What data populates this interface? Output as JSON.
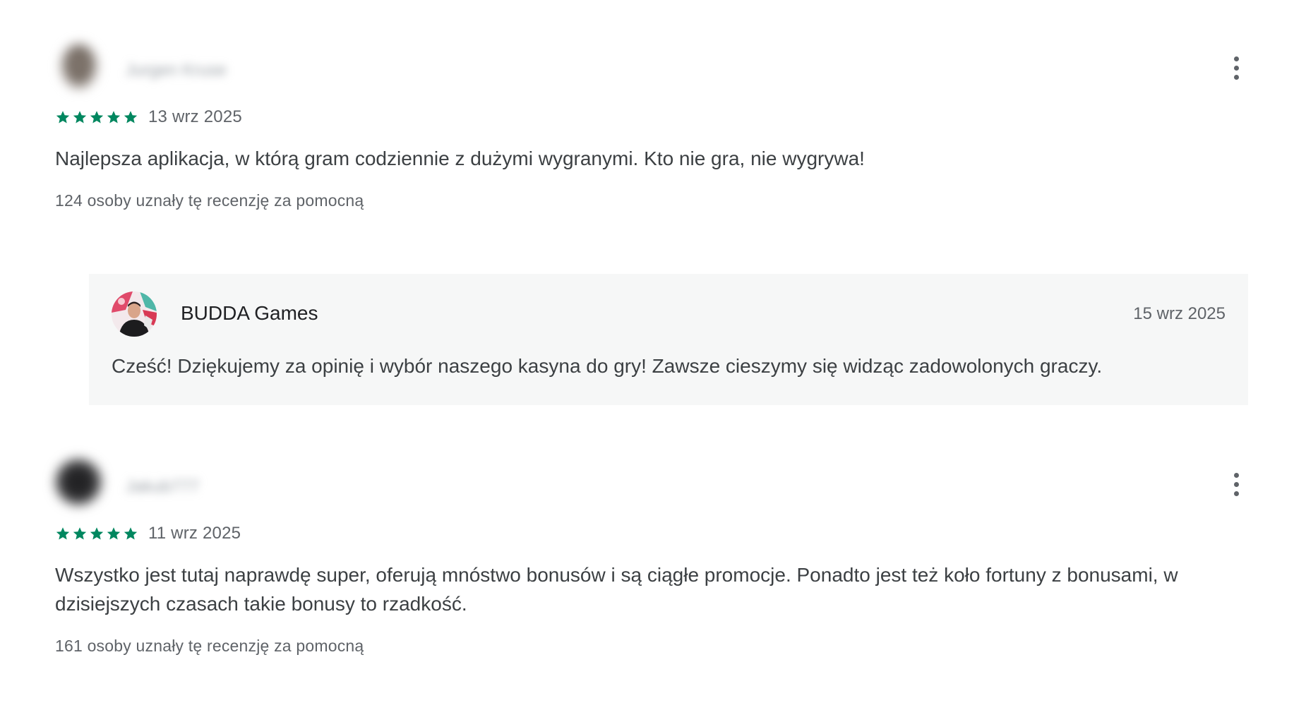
{
  "colors": {
    "star": "#01875f",
    "text": "#3c4043",
    "muted": "#5f6368",
    "reply_background": "#f6f7f7"
  },
  "icons": {
    "star": "star-icon",
    "more": "more-vert-icon"
  },
  "reviews": [
    {
      "author": "Jurgen Kruse",
      "rating": 5,
      "date": "13 wrz 2025",
      "text": "Najlepsza aplikacja, w którą gram codziennie z dużymi wygranymi. Kto nie gra, nie wygrywa!",
      "helpful": "124 osoby uznały tę recenzję za pomocną",
      "reply": {
        "author": "BUDDA Games",
        "date": "15 wrz 2025",
        "text": "Cześć! Dziękujemy za opinię i wybór naszego kasyna do gry! Zawsze cieszymy się widząc zadowolonych graczy."
      }
    },
    {
      "author": "Jakub777",
      "rating": 5,
      "date": "11 wrz 2025",
      "text": "Wszystko jest tutaj naprawdę super, oferują mnóstwo bonusów i są ciągłe promocje. Ponadto jest też koło fortuny z bonusami, w dzisiejszych czasach takie bonusy to rzadkość.",
      "helpful": "161 osoby uznały tę recenzję za pomocną"
    }
  ]
}
